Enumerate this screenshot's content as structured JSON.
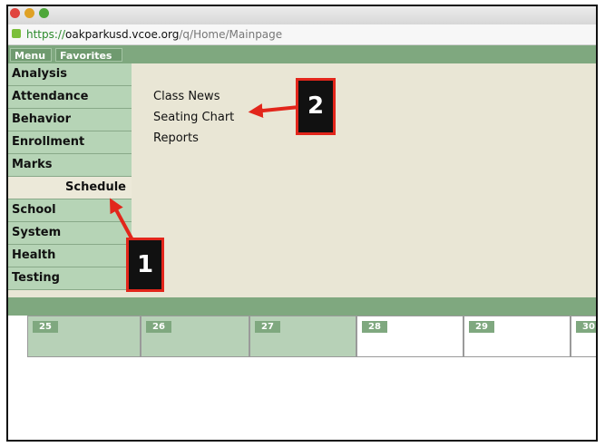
{
  "browser": {
    "url_scheme": "https://",
    "url_host": "oakparkusd.vcoe.org",
    "url_path": "/q/Home/Mainpage"
  },
  "topnav": {
    "menu_label": "Menu",
    "favorites_label": "Favorites"
  },
  "sidebar": {
    "items": [
      {
        "label": "Analysis"
      },
      {
        "label": "Attendance"
      },
      {
        "label": "Behavior"
      },
      {
        "label": "Enrollment"
      },
      {
        "label": "Marks"
      },
      {
        "label": "Schedule"
      },
      {
        "label": "School"
      },
      {
        "label": "System"
      },
      {
        "label": "Health"
      },
      {
        "label": "Testing"
      }
    ]
  },
  "submenu": {
    "items": [
      {
        "label": "Class News"
      },
      {
        "label": "Seating Chart"
      },
      {
        "label": "Reports"
      }
    ]
  },
  "calendar": {
    "days": [
      "25",
      "26",
      "27",
      "28",
      "29",
      "30"
    ]
  },
  "callouts": {
    "one": "1",
    "two": "2"
  },
  "colors": {
    "callout_border": "#e2261b",
    "nav_green": "#7fa87f",
    "panel_bg": "#e9e6d5"
  }
}
